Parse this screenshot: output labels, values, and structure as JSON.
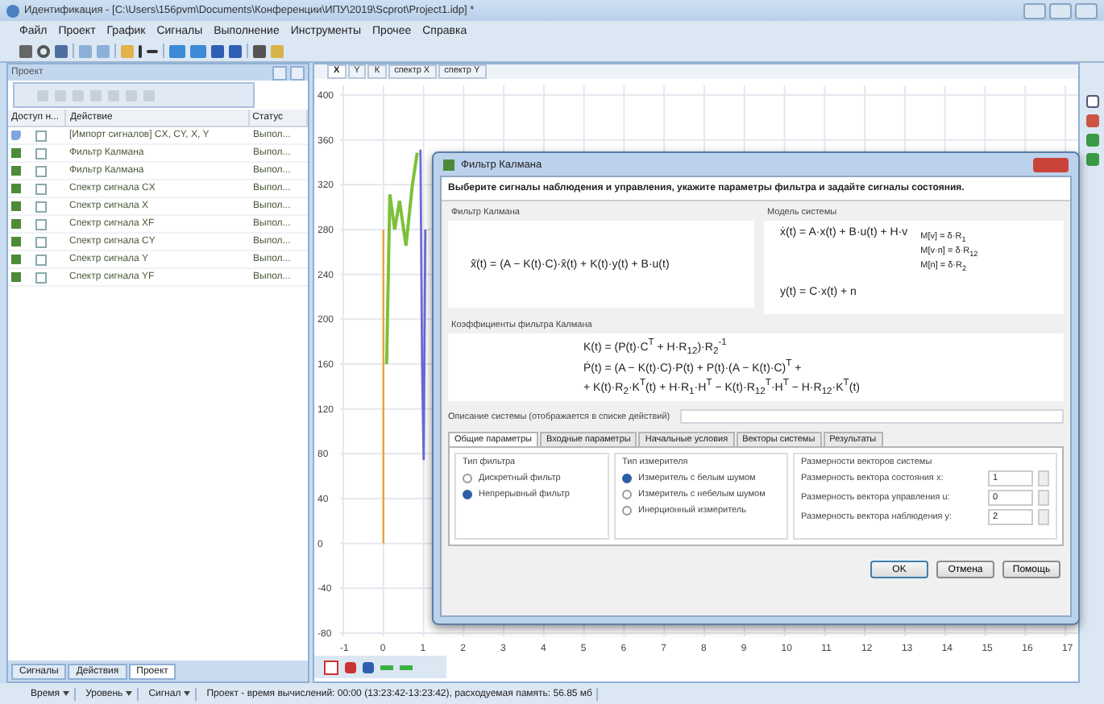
{
  "window": {
    "title": "Идентификация - [C:\\Users\\156pvm\\Documents\\Конференции\\ИПУ\\2019\\Scprot\\Project1.idp] *"
  },
  "menu": [
    "Файл",
    "Проект",
    "График",
    "Сигналы",
    "Выполнение",
    "Инструменты",
    "Прочее",
    "Справка"
  ],
  "project_panel": {
    "title": "Проект",
    "columns": [
      "Доступ н...",
      "Действие",
      "Статус"
    ],
    "rows": [
      {
        "kind": "import",
        "action": "[Импорт сигналов] CX, CY, X, Y",
        "status": "Выпол...",
        "checked": false
      },
      {
        "kind": "action",
        "action": "Фильтр Калмана",
        "status": "Выпол...",
        "checked": false
      },
      {
        "kind": "action",
        "action": "Фильтр Калмана",
        "status": "Выпол...",
        "checked": false
      },
      {
        "kind": "action",
        "action": "Спектр сигнала CX",
        "status": "Выпол...",
        "checked": false
      },
      {
        "kind": "action",
        "action": "Спектр сигнала X",
        "status": "Выпол...",
        "checked": false
      },
      {
        "kind": "action",
        "action": "Спектр сигнала XF",
        "status": "Выпол...",
        "checked": false
      },
      {
        "kind": "action",
        "action": "Спектр сигнала CY",
        "status": "Выпол...",
        "checked": false
      },
      {
        "kind": "action",
        "action": "Спектр сигнала Y",
        "status": "Выпол...",
        "checked": false
      },
      {
        "kind": "action",
        "action": "Спектр сигнала YF",
        "status": "Выпол...",
        "checked": false
      }
    ],
    "tabs": [
      {
        "label": "Сигналы",
        "selected": false
      },
      {
        "label": "Действия",
        "selected": false
      },
      {
        "label": "Проект",
        "selected": true
      }
    ]
  },
  "plot": {
    "tabs": [
      {
        "label": "X",
        "selected": true
      },
      {
        "label": "Y",
        "selected": false
      },
      {
        "label": "К",
        "selected": false
      },
      {
        "label": "спектр X",
        "selected": false
      },
      {
        "label": "спектр Y",
        "selected": false
      }
    ],
    "y_ticks": [
      "400",
      "360",
      "320",
      "280",
      "240",
      "200",
      "160",
      "120",
      "80",
      "40",
      "0",
      "-40",
      "-80"
    ],
    "x_ticks": [
      "-1",
      "0",
      "1",
      "2",
      "3",
      "4",
      "5",
      "6",
      "7",
      "8",
      "9",
      "10",
      "11",
      "12",
      "13",
      "14",
      "15",
      "16",
      "17"
    ]
  },
  "dialog": {
    "title": "Фильтр Калмана",
    "instruction": "Выберите сигналы наблюдения и управления, укажите параметры фильтра и задайте сигналы состояния.",
    "filter_group": {
      "title": "Фильтр Калмана",
      "formula": "x̂̇(t) = (A − K(t)·C)·x̂(t) + K(t)·y(t) + B·u(t)"
    },
    "model_group": {
      "title": "Модель системы",
      "equations": [
        "ẋ(t) = A·x(t) + B·u(t) + H·v",
        "y(t) = C·x(t) + n"
      ],
      "noise": [
        "M[v] = δ·R$_{1}$",
        "M[v·n] = δ·R$_{12}$",
        "M[n] = δ·R$_{2}$"
      ]
    },
    "coefficients_group": {
      "title": "Коэффициенты фильтра Калмана",
      "lines": [
        "K(t) = (P(t)·C$^{T}$ + H·R$_{12}$)·R$_{2}$$^{-1}$",
        "Ṗ(t) = (A − K(t)·C)·P(t) + P(t)·(A − K(t)·C)$^{T}$ +",
        "+ K(t)·R$_{2}$·K$^{T}$(t) + H·R$_{1}$·H$^{T}$ − K(t)·R$_{12}$$^{T}$·H$^{T}$ − H·R$_{12}$·K$^{T}$(t)"
      ]
    },
    "description_label": "Описание системы (отображается в списке действий)",
    "tabs": [
      {
        "label": "Общие параметры",
        "selected": true
      },
      {
        "label": "Входные параметры",
        "selected": false
      },
      {
        "label": "Начальные условия",
        "selected": false
      },
      {
        "label": "Векторы системы",
        "selected": false
      },
      {
        "label": "Результаты",
        "selected": false
      }
    ],
    "filter_type": {
      "title": "Тип фильтра",
      "options": [
        {
          "label": "Дискретный фильтр",
          "selected": false
        },
        {
          "label": "Непрерывный фильтр",
          "selected": true
        }
      ]
    },
    "meter_type": {
      "title": "Тип измерителя",
      "options": [
        {
          "label": "Измеритель с белым шумом",
          "selected": true
        },
        {
          "label": "Измеритель с небелым шумом",
          "selected": false
        },
        {
          "label": "Инерционный измеритель",
          "selected": false
        }
      ]
    },
    "dimensions": {
      "title": "Размерности векторов системы",
      "fields": [
        {
          "label": "Размерность вектора состояния x:",
          "value": "1"
        },
        {
          "label": "Размерность вектора управления u:",
          "value": "0"
        },
        {
          "label": "Размерность вектора наблюдения y:",
          "value": "2"
        }
      ]
    },
    "buttons": [
      "OK",
      "Отмена",
      "Помощь"
    ]
  },
  "status_bar": [
    {
      "kind": "dropdown",
      "text": "Время"
    },
    {
      "kind": "dropdown",
      "text": "Уровень"
    },
    {
      "kind": "dropdown",
      "text": "Сигнал"
    },
    {
      "kind": "text",
      "text": "Проект - время вычислений: 00:00 (13:23:42-13:23:42), расходуемая память: 56.85 мб"
    }
  ]
}
